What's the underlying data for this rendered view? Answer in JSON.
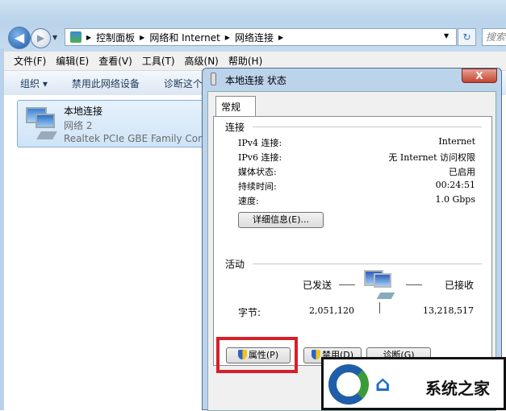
{
  "explorer": {
    "breadcrumb": [
      "控制面板",
      "网络和 Internet",
      "网络连接"
    ],
    "search_placeholder": "搜索",
    "menu": [
      "文件(F)",
      "编辑(E)",
      "查看(V)",
      "工具(T)",
      "高级(N)",
      "帮助(H)"
    ],
    "toolbar": [
      "组织 ▾",
      "禁用此网络设备",
      "诊断这个连接"
    ],
    "connection": {
      "name": "本地连接",
      "network": "网络  2",
      "adapter": "Realtek PCIe GBE Family Controller"
    }
  },
  "dialog": {
    "title": "本地连接 状态",
    "close": "X",
    "tab": "常规",
    "connection_header": "连接",
    "rows": [
      {
        "label": "IPv4 连接:",
        "value": "Internet"
      },
      {
        "label": "IPv6 连接:",
        "value": "无 Internet 访问权限"
      },
      {
        "label": "媒体状态:",
        "value": "已启用"
      },
      {
        "label": "持续时间:",
        "value": "00:24:51"
      },
      {
        "label": "速度:",
        "value": "1.0 Gbps"
      }
    ],
    "details_button": "详细信息(E)...",
    "activity_header": "活动",
    "sent_label": "已发送",
    "received_label": "已接收",
    "bytes_label": "字节:",
    "bytes_sent": "2,051,120",
    "bytes_received": "13,218,517",
    "properties_button": "属性(P)",
    "disable_button": "禁用(D)",
    "diagnose_button": "诊断(G)"
  },
  "watermark": {
    "text": "系统之家"
  },
  "colors": {
    "highlight": "#d5202a",
    "accent": "#1c6fc7"
  }
}
